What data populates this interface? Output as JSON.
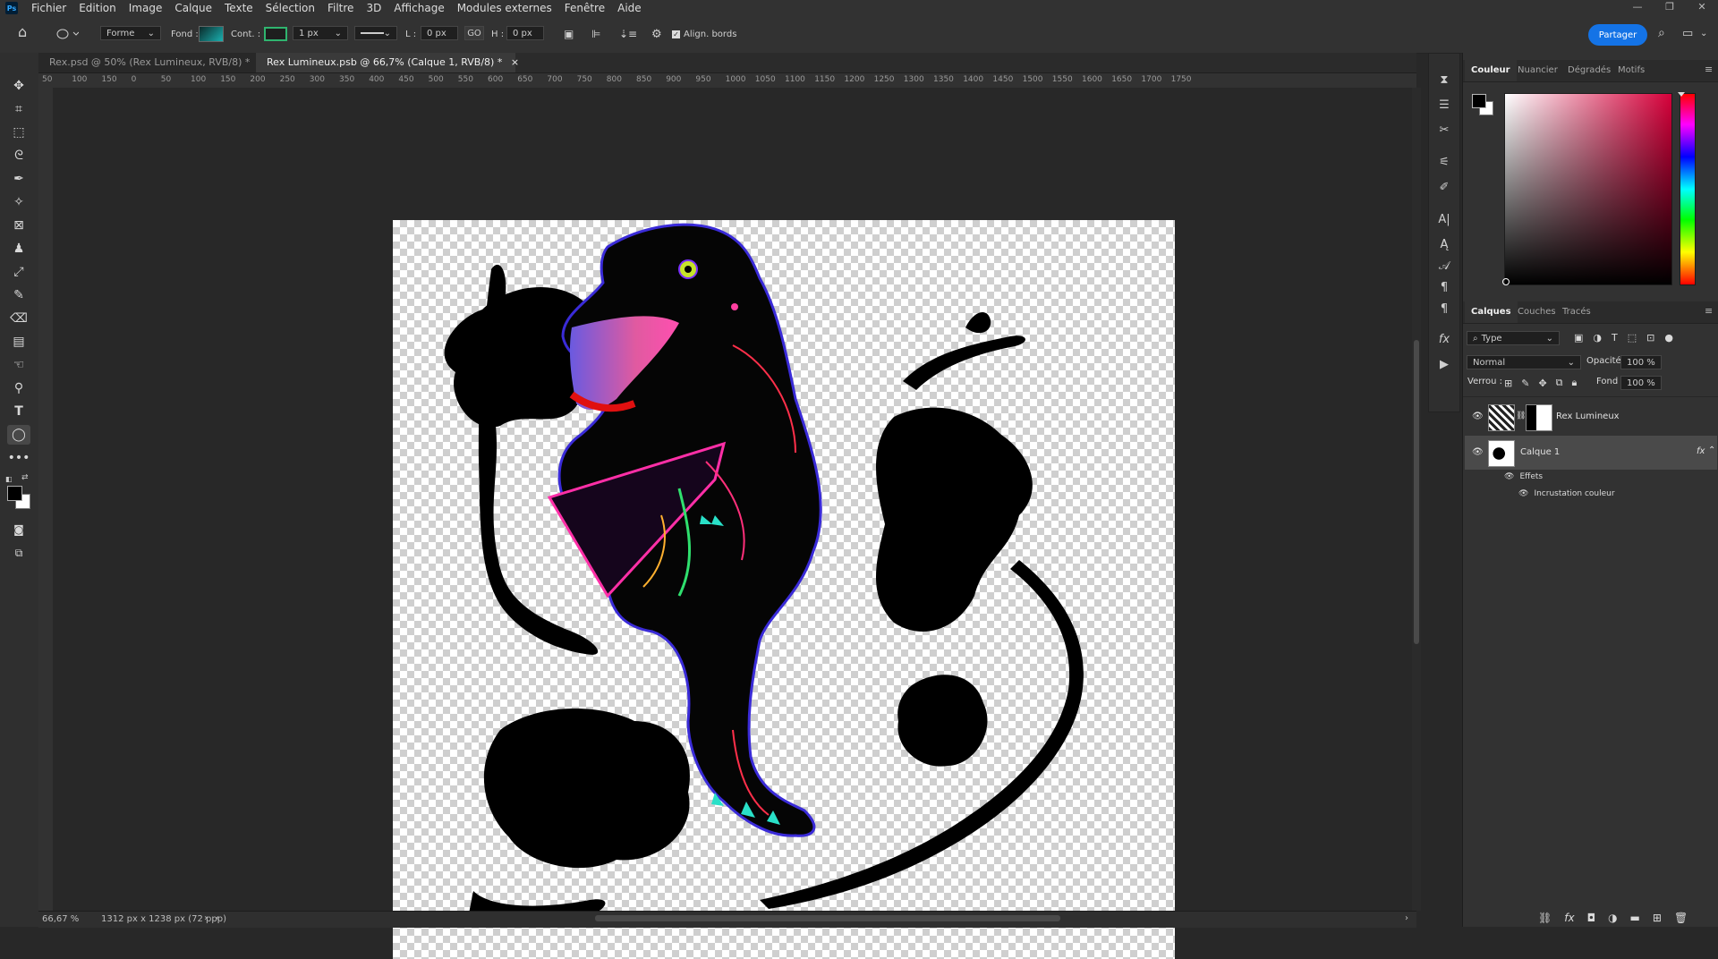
{
  "app": {
    "logo": "Ps",
    "window_controls": [
      "—",
      "❐",
      "✕"
    ]
  },
  "menu": [
    "Fichier",
    "Edition",
    "Image",
    "Calque",
    "Texte",
    "Sélection",
    "Filtre",
    "3D",
    "Affichage",
    "Modules externes",
    "Fenêtre",
    "Aide"
  ],
  "options": {
    "shape_mode": "Forme",
    "fill_label": "Fond :",
    "stroke_label": "Cont. :",
    "stroke_width": "1 px",
    "width_label": "L :",
    "width_value": "0 px",
    "link_label": "GO",
    "height_label": "H :",
    "height_value": "0 px",
    "align_edges_label": "Align. bords",
    "align_edges_checked": true,
    "share_label": "Partager",
    "fill_color": "#1ab0b0",
    "stroke_color": "#2fb56f"
  },
  "tabs": [
    {
      "label": "Rex.psd @ 50% (Rex Lumineux, RVB/8) *",
      "active": false
    },
    {
      "label": "Rex Lumineux.psb @ 66,7% (Calque 1, RVB/8) *",
      "active": true
    }
  ],
  "ruler_ticks": [
    "50",
    "100",
    "150",
    "0",
    "50",
    "100",
    "150",
    "200",
    "250",
    "300",
    "350",
    "400",
    "450",
    "500",
    "550",
    "600",
    "650",
    "700",
    "750",
    "800",
    "850",
    "900",
    "950",
    "1000",
    "1050",
    "1100",
    "1150",
    "1200",
    "1250",
    "1300",
    "1350",
    "1400",
    "1450",
    "1500",
    "1550",
    "1600",
    "1650",
    "1700",
    "1750"
  ],
  "status": {
    "zoom": "66,67 %",
    "doc_info": "1312 px x 1238 px (72 ppp)"
  },
  "color_panel": {
    "tabs": [
      "Couleur",
      "Nuancier",
      "Dégradés",
      "Motifs"
    ],
    "active_tab": "Couleur",
    "foreground": "#000000",
    "background": "#ffffff",
    "hue_color": "#d6003a"
  },
  "layers_panel": {
    "tabs": [
      "Calques",
      "Couches",
      "Tracés"
    ],
    "active_tab": "Calques",
    "filter_label": "Type",
    "blend_mode": "Normal",
    "opacity_label": "Opacité :",
    "opacity_value": "100 %",
    "lock_label": "Verrou :",
    "fill_label": "Fond :",
    "fill_value": "100 %",
    "layers": [
      {
        "name": "Rex Lumineux",
        "visible": true,
        "selected": false,
        "has_mask": true
      },
      {
        "name": "Calque 1",
        "visible": true,
        "selected": true,
        "fx": "fx"
      }
    ],
    "effects_label": "Effets",
    "effect_items": [
      "Incrustation couleur"
    ]
  }
}
